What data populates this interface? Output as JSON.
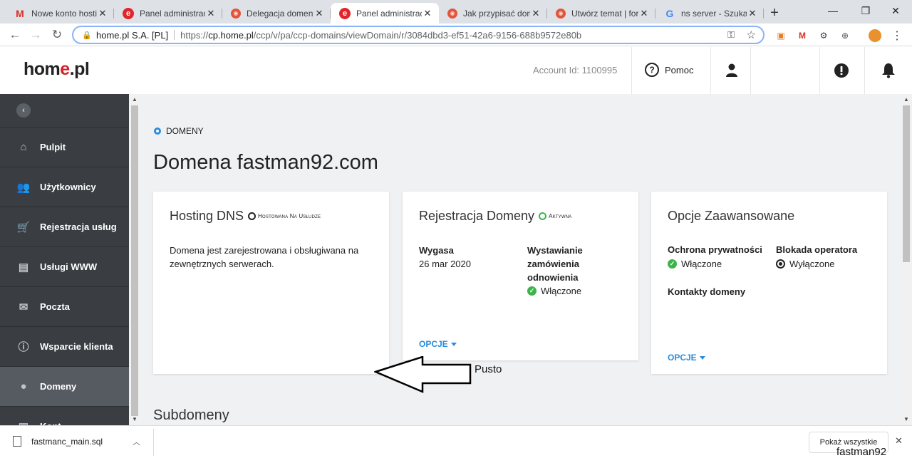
{
  "browser": {
    "tabs": [
      {
        "icon": "gmail-icon",
        "title": "Nowe konto hostin"
      },
      {
        "icon": "homepl-icon",
        "title": "Panel administracy"
      },
      {
        "icon": "lifebuoy-icon",
        "title": "Delegacja domeny"
      },
      {
        "icon": "homepl-icon",
        "title": "Panel administracy",
        "active": true
      },
      {
        "icon": "lifebuoy-icon",
        "title": "Jak przypisać dom"
      },
      {
        "icon": "lifebuoy-icon",
        "title": "Utwórz temat | for"
      },
      {
        "icon": "google-icon",
        "title": "ns server - Szukaj v"
      }
    ],
    "tab_glyph": {
      "gmail-icon": "M",
      "homepl-icon": "e",
      "lifebuoy-icon": "",
      "google-icon": "G"
    },
    "address": {
      "org": "home.pl S.A. [PL]",
      "url_prefix": "https://",
      "url_host": "cp.home.pl",
      "url_path": "/ccp/v/pa/ccp-domains/viewDomain/r/3084dbd3-ef51-42a6-9156-688b9572e80b"
    }
  },
  "header": {
    "logo_a": "hom",
    "logo_b": "e",
    "logo_c": ".pl",
    "account": "Account Id: 1100995",
    "help": "Pomoc"
  },
  "sidebar": {
    "items": [
      {
        "icon": "home-icon",
        "glyph": "⌂",
        "label": "Pulpit"
      },
      {
        "icon": "users-icon",
        "glyph": "👥",
        "label": "Użytkownicy"
      },
      {
        "icon": "cart-icon",
        "glyph": "🛒",
        "label": "Rejestracja usług"
      },
      {
        "icon": "server-icon",
        "glyph": "▤",
        "label": "Usługi WWW"
      },
      {
        "icon": "mail-icon",
        "glyph": "✉",
        "label": "Poczta"
      },
      {
        "icon": "info-icon",
        "glyph": "ⓘ",
        "label": "Wsparcie klienta"
      },
      {
        "icon": "globe-icon",
        "glyph": "●",
        "label": "Domeny",
        "active": true
      },
      {
        "icon": "briefcase-icon",
        "glyph": "▣",
        "label": "Kont"
      }
    ]
  },
  "main": {
    "breadcrumb": "DOMENY",
    "title": "Domena fastman92.com",
    "cards": {
      "dns": {
        "title": "Hosting DNS",
        "badge": "Hostowana Na Usłudze",
        "text": "Domena jest zarejestrowana i obsługiwana na zewnętrznych serwerach."
      },
      "reg": {
        "title": "Rejestracja Domeny",
        "badge": "Aktywna",
        "expires_label": "Wygasa",
        "expires_value": "26 mar 2020",
        "renew_label": "Wystawianie zamówienia odnowienia",
        "renew_value": "Włączone",
        "options": "OPCJE"
      },
      "adv": {
        "title": "Opcje Zaawansowane",
        "privacy_label": "Ochrona prywatności",
        "privacy_value": "Włączone",
        "lock_label": "Blokada operatora",
        "lock_value": "Wyłączone",
        "contacts_label": "Kontakty domeny",
        "options": "OPCJE"
      }
    },
    "subdomains_title": "Subdomeny",
    "annotation": "Pusto"
  },
  "downloads": {
    "file": "fastmanc_main.sql",
    "show_all": "Pokaż wszystkie"
  },
  "corner_label": "fastman92",
  "colors": {
    "accent": "#2a8cdb",
    "brand_red": "#d71f26",
    "sidebar": "#3a3e43",
    "ok_green": "#3bb54a"
  }
}
